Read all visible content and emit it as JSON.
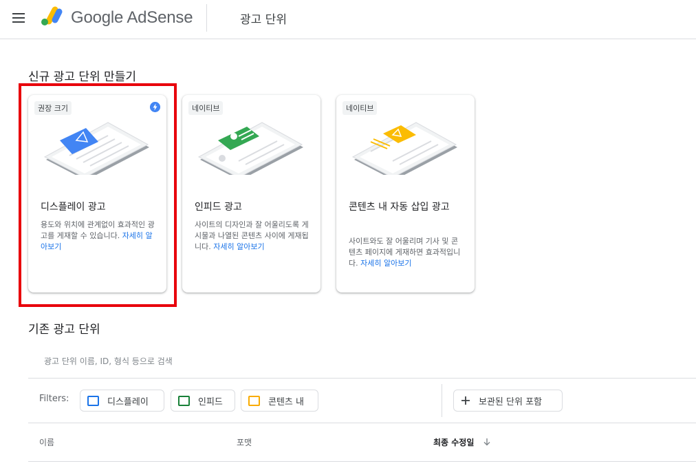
{
  "header": {
    "brand": "Google AdSense",
    "page_title": "광고 단위"
  },
  "create": {
    "section_title": "신규 광고 단위 만들기",
    "cards": [
      {
        "tag": "권장 크기",
        "title": "디스플레이 광고",
        "desc": "용도와 위치에 관계없이 효과적인 광고를 게재할 수 있습니다.",
        "link": "자세히 알아보기",
        "accent": "#4285f4"
      },
      {
        "tag": "네이티브",
        "title": "인피드 광고",
        "desc": "사이트의 디자인과 잘 어울리도록 게시물과 나열된 콘텐츠 사이에 게재됩니다.",
        "link": "자세히 알아보기",
        "accent": "#34a853"
      },
      {
        "tag": "네이티브",
        "title": "콘텐츠 내 자동 삽입 광고",
        "desc": "사이트와도 잘 어울리며 기사 및 콘텐츠 페이지에 게재하면 효과적입니다.",
        "link": "자세히 알아보기",
        "accent": "#fbbc04"
      }
    ]
  },
  "existing": {
    "section_title": "기존 광고 단위",
    "search_placeholder": "광고 단위 이름, ID, 형식 등으로 검색",
    "filters_label": "Filters:",
    "filters": [
      {
        "label": "디스플레이",
        "color": "#1a73e8"
      },
      {
        "label": "인피드",
        "color": "#188038"
      },
      {
        "label": "콘텐츠 내",
        "color": "#f9ab00"
      }
    ],
    "archived_label": "보관된 단위 포함",
    "columns": [
      "이름",
      "포맷",
      "최종 수정일"
    ]
  }
}
